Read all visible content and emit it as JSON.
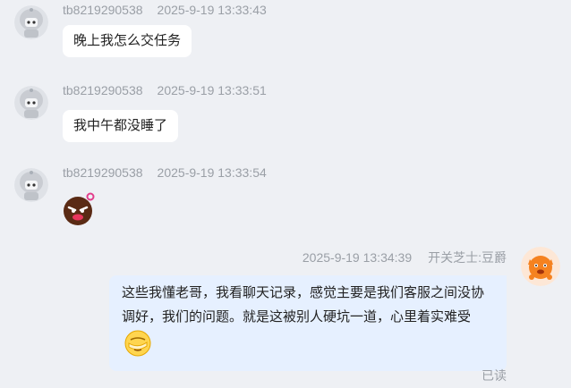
{
  "messages": [
    {
      "sender": "tb8219290538",
      "time": "2025-9-19 13:33:43",
      "text": "晚上我怎么交任务",
      "avatar_icon": "robot-avatar"
    },
    {
      "sender": "tb8219290538",
      "time": "2025-9-19 13:33:51",
      "text": "我中午都没睡了",
      "avatar_icon": "robot-avatar"
    },
    {
      "sender": "tb8219290538",
      "time": "2025-9-19 13:33:54",
      "sticker": "angry-face-sticker",
      "avatar_icon": "robot-avatar"
    }
  ],
  "outgoing": {
    "time": "2025-9-19 13:34:39",
    "sender": "开关芝士:豆爵",
    "text": "这些我懂老哥，我看聊天记录，感觉主要是我们客服之间没协调好，我们的问题。就是这被别人硬坑一道，心里着实难受",
    "trailing_emoji": "facepalm-emoji",
    "avatar_icon": "orange-mascot-avatar",
    "status": "已读"
  },
  "colors": {
    "background": "#eef0f4",
    "incoming_bubble": "#ffffff",
    "outgoing_bubble": "#e6f0ff",
    "meta_text": "#9a9fa6"
  }
}
